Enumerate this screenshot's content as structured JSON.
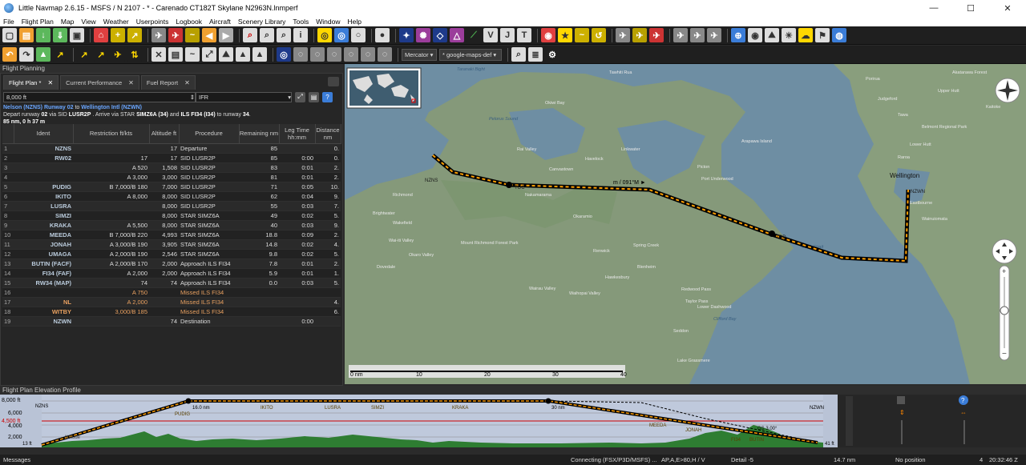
{
  "window": {
    "title": "Little Navmap 2.6.15 - MSFS / N 2107 - * - Carenado CT182T Skylane N2963N.lnmperf",
    "minimize": "—",
    "maximize": "☐",
    "close": "✕"
  },
  "menu": [
    "File",
    "Flight Plan",
    "Map",
    "View",
    "Weather",
    "Userpoints",
    "Logbook",
    "Aircraft",
    "Scenery Library",
    "Tools",
    "Window",
    "Help"
  ],
  "toolbar2": {
    "projection": "Mercator",
    "theme": "* google-maps-def"
  },
  "dock": {
    "title": "Flight Planning",
    "tabs": [
      {
        "label": "Flight Plan *",
        "close": "✕"
      },
      {
        "label": "Current Performance",
        "close": "✕"
      },
      {
        "label": "Fuel Report",
        "close": "✕"
      }
    ],
    "cruise_altitude": "8,000 ft",
    "flight_rules": "IFR",
    "route": {
      "departure": "Nelson (NZNS) Runway 02",
      "to": "to",
      "destination": "Wellington Intl (NZWN)",
      "line2_a": "Depart runway",
      "runway": "02",
      "line2_b": "via SID",
      "sid": "LUSR2P",
      "line2_c": ". Arrive via STAR",
      "star": "SIMZ6A (34)",
      "line2_d": "and",
      "approach": "ILS FI34 (I34)",
      "line2_e": "to runway",
      "arr_rwy": "34",
      "line2_f": ".",
      "summary": "85 nm, 0 h 37 m"
    }
  },
  "table": {
    "headers": {
      "ident": "Ident",
      "restriction": "Restriction ft/kts",
      "altitude": "Altitude ft",
      "procedure": "Procedure",
      "remaining": "Remaining nm",
      "legtime": "Leg Time hh:mm",
      "distance": "Distance nm"
    },
    "rows": [
      {
        "n": "1",
        "ident": "NZNS",
        "restr": "",
        "alt": "17",
        "proc": "Departure",
        "rem": "85",
        "leg": "",
        "dist": "0."
      },
      {
        "n": "2",
        "ident": "RW02",
        "restr": "17",
        "alt": "17",
        "proc": "SID LUSR2P",
        "rem": "85",
        "leg": "0:00",
        "dist": "0."
      },
      {
        "n": "3",
        "ident": "",
        "restr": "A 520",
        "alt": "1,508",
        "proc": "SID LUSR2P",
        "rem": "83",
        "leg": "0:01",
        "dist": "2."
      },
      {
        "n": "4",
        "ident": "",
        "restr": "A 3,000",
        "alt": "3,000",
        "proc": "SID LUSR2P",
        "rem": "81",
        "leg": "0:01",
        "dist": "2."
      },
      {
        "n": "5",
        "ident": "PUDIG",
        "restr": "B 7,000/B 180",
        "alt": "7,000",
        "proc": "SID LUSR2P",
        "rem": "71",
        "leg": "0:05",
        "dist": "10."
      },
      {
        "n": "6",
        "ident": "IKITO",
        "restr": "A 8,000",
        "alt": "8,000",
        "proc": "SID LUSR2P",
        "rem": "62",
        "leg": "0:04",
        "dist": "9."
      },
      {
        "n": "7",
        "ident": "LUSRA",
        "restr": "",
        "alt": "8,000",
        "proc": "SID LUSR2P",
        "rem": "55",
        "leg": "0:03",
        "dist": "7."
      },
      {
        "n": "8",
        "ident": "SIMZI",
        "restr": "",
        "alt": "8,000",
        "proc": "STAR SIMZ6A",
        "rem": "49",
        "leg": "0:02",
        "dist": "5."
      },
      {
        "n": "9",
        "ident": "KRAKA",
        "restr": "A 5,500",
        "alt": "8,000",
        "proc": "STAR SIMZ6A",
        "rem": "40",
        "leg": "0:03",
        "dist": "9."
      },
      {
        "n": "10",
        "ident": "MEEDA",
        "restr": "B 7,000/B 220",
        "alt": "4,993",
        "proc": "STAR SIMZ6A",
        "rem": "18.8",
        "leg": "0:09",
        "dist": "2."
      },
      {
        "n": "11",
        "ident": "JONAH",
        "restr": "A 3,000/B 190",
        "alt": "3,905",
        "proc": "STAR SIMZ6A",
        "rem": "14.8",
        "leg": "0:02",
        "dist": "4."
      },
      {
        "n": "12",
        "ident": "UMAGA",
        "restr": "A 2,000/B 190",
        "alt": "2,546",
        "proc": "STAR SIMZ6A",
        "rem": "9.8",
        "leg": "0:02",
        "dist": "5."
      },
      {
        "n": "13",
        "ident": "BUTIN (FACF)",
        "restr": "A 2,000/B 170",
        "alt": "2,000",
        "proc": "Approach ILS FI34",
        "rem": "7.8",
        "leg": "0:01",
        "dist": "2."
      },
      {
        "n": "14",
        "ident": "FI34 (FAF)",
        "restr": "A 2,000",
        "alt": "2,000",
        "proc": "Approach ILS FI34",
        "rem": "5.9",
        "leg": "0:01",
        "dist": "1."
      },
      {
        "n": "15",
        "ident": "RW34 (MAP)",
        "restr": "74",
        "alt": "74",
        "proc": "Approach ILS FI34",
        "rem": "0.0",
        "leg": "0:03",
        "dist": "5."
      },
      {
        "n": "16",
        "ident": "",
        "restr": "A 750",
        "alt": "",
        "proc": "Missed ILS FI34",
        "rem": "",
        "leg": "",
        "dist": "",
        "missed": true
      },
      {
        "n": "17",
        "ident": "NL",
        "restr": "A 2,000",
        "alt": "",
        "proc": "Missed ILS FI34",
        "rem": "",
        "leg": "",
        "dist": "4.",
        "missed": true
      },
      {
        "n": "18",
        "ident": "WITBY",
        "restr": "3,000/B 185",
        "alt": "",
        "proc": "Missed ILS FI34",
        "rem": "",
        "leg": "",
        "dist": "6.",
        "missed": true
      },
      {
        "n": "19",
        "ident": "NZWN",
        "restr": "",
        "alt": "74",
        "proc": "Destination",
        "rem": "",
        "leg": "0:00",
        "dist": ""
      }
    ]
  },
  "map": {
    "scale_labels": [
      "0 nm",
      "10",
      "20",
      "30",
      "40"
    ],
    "leg_label": "m / 091°M ►",
    "places": [
      {
        "name": "Tawhiti Rua",
        "class": "land"
      },
      {
        "name": "Okiwi Bay",
        "class": "land"
      },
      {
        "name": "Rai Valley",
        "class": "land"
      },
      {
        "name": "Havelock",
        "class": "land"
      },
      {
        "name": "Canvastown",
        "class": "land"
      },
      {
        "name": "Linkwater",
        "class": "land"
      },
      {
        "name": "Nakamarama",
        "class": "land"
      },
      {
        "name": "Okaramio",
        "class": "land"
      },
      {
        "name": "Renwick",
        "class": "land"
      },
      {
        "name": "Blenheim",
        "class": "land"
      },
      {
        "name": "Spring Creek",
        "class": "land"
      },
      {
        "name": "Hawkesbury",
        "class": "land"
      },
      {
        "name": "Wairau Valley",
        "class": "land"
      },
      {
        "name": "Waihopai Valley",
        "class": "land"
      },
      {
        "name": "Seddon",
        "class": "land"
      },
      {
        "name": "Lake Grassmere",
        "class": "land"
      },
      {
        "name": "Mount Richmond Forest Park",
        "class": "land"
      },
      {
        "name": "Richmond",
        "class": "land"
      },
      {
        "name": "Brightwater",
        "class": "land"
      },
      {
        "name": "Wakefield",
        "class": "land"
      },
      {
        "name": "Dovedale",
        "class": "land"
      },
      {
        "name": "Wai-iti Valley",
        "class": "land"
      },
      {
        "name": "Okaro Valley",
        "class": "land"
      },
      {
        "name": "Arapawa Island",
        "class": "land"
      },
      {
        "name": "Picton",
        "class": "land"
      },
      {
        "name": "Port Underwood",
        "class": "land"
      },
      {
        "name": "Redwood Pass",
        "class": "land"
      },
      {
        "name": "Taylor Pass",
        "class": "land"
      },
      {
        "name": "Lower Dashwood",
        "class": "land"
      },
      {
        "name": "Clifford Bay",
        "class": "water"
      },
      {
        "name": "Cook Strait",
        "class": "water"
      },
      {
        "name": "Wellington",
        "class": "city"
      },
      {
        "name": "Lower Hutt",
        "class": "land"
      },
      {
        "name": "Upper Hutt",
        "class": "land"
      },
      {
        "name": "Belmont Regional Park",
        "class": "land"
      },
      {
        "name": "Akatarawa Forest",
        "class": "land"
      },
      {
        "name": "Kaitoke",
        "class": "land"
      },
      {
        "name": "Judgeford",
        "class": "land"
      },
      {
        "name": "Tawa",
        "class": "land"
      },
      {
        "name": "Wainuiomata",
        "class": "land"
      },
      {
        "name": "Eastbourne",
        "class": "land"
      },
      {
        "name": "Porirua",
        "class": "land"
      },
      {
        "name": "Raroa",
        "class": "land"
      },
      {
        "name": "Tasman Bay",
        "class": "water"
      },
      {
        "name": "Taranaki Bight",
        "class": "water"
      },
      {
        "name": "Pelorus Sound",
        "class": "water"
      }
    ],
    "waypoints": [
      "NZNS",
      "PUDIG",
      "IKITO",
      "LUSRA",
      "SIMZI",
      "KRAKA",
      "MEEDA",
      "NZWN",
      "TOC",
      "TOD"
    ]
  },
  "elevation": {
    "title": "Flight Plan Elevation Profile",
    "alt_labels": [
      "8,000 ft",
      "6,000",
      "4,500 ft",
      "4,000",
      "2,000",
      "0 ft"
    ],
    "left_label": "13 ft",
    "right_label": "41 ft",
    "labels": [
      "PUDIG",
      "IKITO",
      "LUSRA",
      "SIMZI",
      "KRAKA",
      "MEEDA",
      "JONAH",
      "FI34",
      "NZWN",
      "NZNS",
      "Altitude"
    ],
    "toc": "16.0 nm",
    "tod": "30 nm",
    "wp_annot": "BUTIN",
    "gs_label": "GS 3.00°"
  },
  "status": {
    "messages": "Messages",
    "connect": "Connecting (FSX/P3D/MSFS) ...",
    "ap": "AP,A,E>80,H / V",
    "detail": "Detail -5",
    "dist": "14.7 nm",
    "position": "No position",
    "count": "4",
    "time": "20:32:46 Z"
  },
  "colors": {
    "accent": "#6aa6ff",
    "route": "#000000",
    "route_inner": "#ffa000",
    "land": "#859a78",
    "water": "#6e8ea3",
    "terrain": "#2e7d32",
    "missed": "#e8a060"
  }
}
